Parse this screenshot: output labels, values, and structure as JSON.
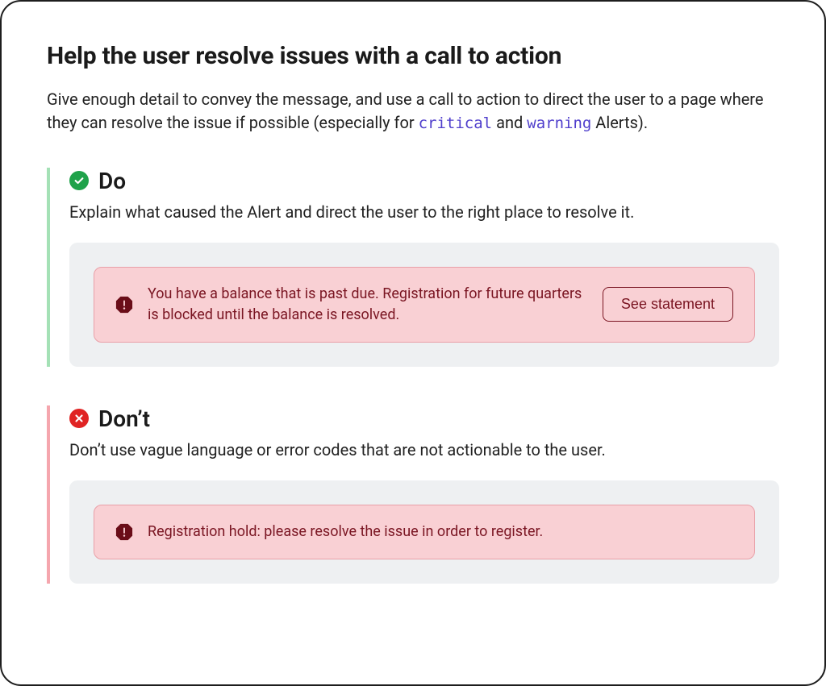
{
  "heading": "Help the user resolve issues with a call to action",
  "intro": {
    "part1": "Give enough detail to convey the message, and use a call to action to direct the user to a page where they can resolve the issue if possible (especially for ",
    "code1": "critical",
    "part2": " and ",
    "code2": "warning",
    "part3": " Alerts)."
  },
  "do": {
    "label": "Do",
    "desc": "Explain what caused the Alert and direct the user to the right place to resolve it.",
    "alert_text": "You have a balance that is past due. Registration for future quarters is blocked until the balance is resolved.",
    "button": "See statement"
  },
  "dont": {
    "label": "Don’t",
    "desc": "Don’t use vague language or error codes that are not actionable to the user.",
    "alert_text": "Registration hold: please resolve the issue in order to register."
  },
  "colors": {
    "do_border": "#a4e1b6",
    "dont_border": "#f5a6ae",
    "do_badge": "#1fa24a",
    "dont_badge": "#e02424",
    "alert_bg": "#f9d0d4",
    "alert_border": "#e9a0a8",
    "alert_text": "#7a1522",
    "code_text": "#4f3ecc"
  }
}
